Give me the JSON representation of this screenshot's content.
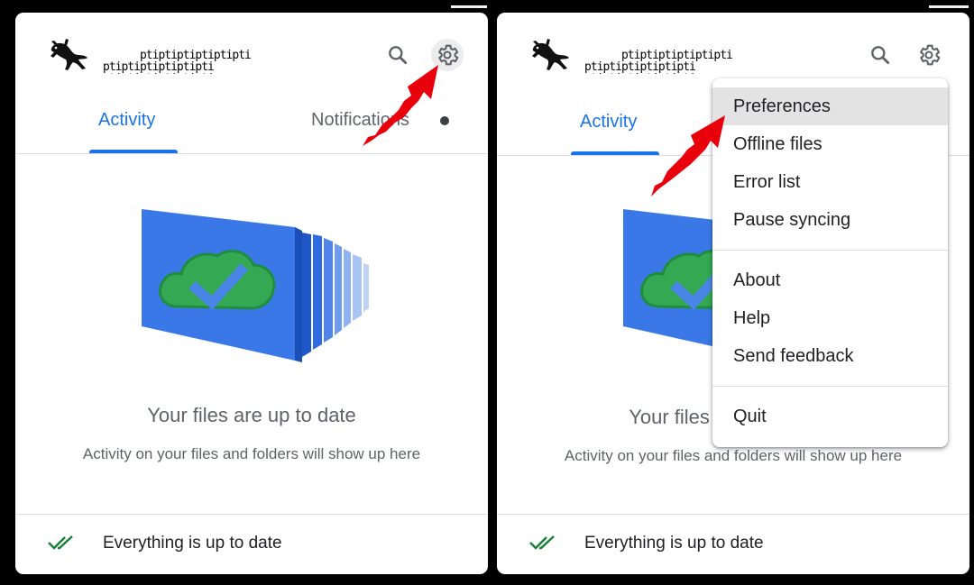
{
  "account_label": "ptiptiptiptiptipti",
  "tabs": {
    "activity": "Activity",
    "notifications": "Notifications"
  },
  "empty_state": {
    "title": "Your files are up to date",
    "subtitle": "Activity on your files and folders will show up here"
  },
  "footer": {
    "status": "Everything is up to date"
  },
  "menu": {
    "items": [
      "Preferences",
      "Offline files",
      "Error list",
      "Pause syncing",
      "About",
      "Help",
      "Send feedback",
      "Quit"
    ],
    "highlighted": "Preferences"
  },
  "colors": {
    "accent": "#1a73e8",
    "annotation_arrow": "#e8000b",
    "check": "#188038"
  },
  "icons": [
    "gecko-logo-icon",
    "search-icon",
    "gear-icon",
    "cloud-check-icon",
    "double-check-icon",
    "red-arrow-annotation"
  ]
}
